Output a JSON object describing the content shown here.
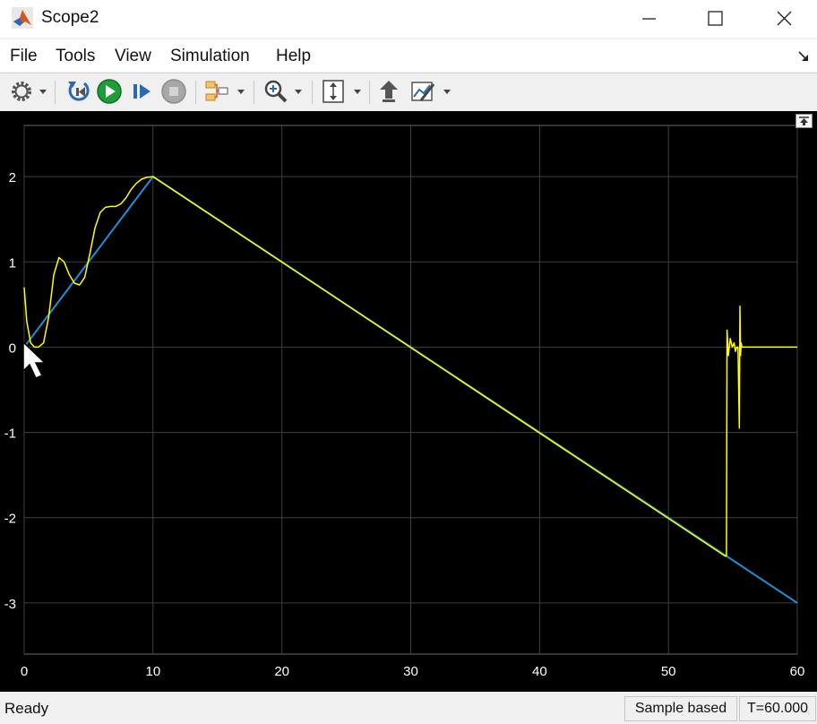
{
  "window": {
    "title": "Scope2"
  },
  "menu": {
    "items": [
      "File",
      "Tools",
      "View",
      "Simulation",
      "Help"
    ]
  },
  "toolbar": {
    "icons": [
      "gear-icon",
      "step-back-icon",
      "run-icon",
      "step-forward-icon",
      "stop-icon",
      "signal-triggers-icon",
      "zoom-icon",
      "scale-axes-icon",
      "highlight-block-icon",
      "style-icon"
    ]
  },
  "status": {
    "ready": "Ready",
    "mode": "Sample based",
    "time": "T=60.000"
  },
  "colors": {
    "background": "#000000",
    "grid": "#404040",
    "axis_text": "#ffffff",
    "signal1": "#ffff00",
    "signal2": "#1e90d6"
  },
  "chart_data": {
    "type": "line",
    "title": "",
    "xlabel": "",
    "ylabel": "",
    "xlim": [
      0,
      60
    ],
    "ylim": [
      -3.6,
      2.6
    ],
    "xticks": [
      0,
      10,
      20,
      30,
      40,
      50,
      60
    ],
    "yticks": [
      -3,
      -2,
      -1,
      0,
      1,
      2
    ],
    "grid": true,
    "series": [
      {
        "color": "#1e90d6",
        "x": [
          0,
          10,
          60
        ],
        "y": [
          0,
          2,
          -3
        ]
      },
      {
        "color": "#ffff00",
        "x": [
          0,
          0.2,
          0.5,
          0.8,
          1.1,
          1.5,
          1.9,
          2.3,
          2.7,
          3.1,
          3.5,
          3.9,
          4.3,
          4.7,
          5.1,
          5.5,
          5.9,
          6.3,
          6.7,
          7.1,
          7.5,
          7.9,
          8.3,
          8.7,
          9.1,
          9.5,
          10,
          54.4,
          54.5,
          54.55,
          54.65,
          54.8,
          54.95,
          55.1,
          55.2,
          55.3,
          55.4,
          55.5,
          55.55,
          55.6,
          55.65,
          55.7,
          55.8,
          56,
          60
        ],
        "y": [
          0.7,
          0.3,
          0.05,
          0.0,
          0.0,
          0.05,
          0.35,
          0.85,
          1.05,
          1.0,
          0.85,
          0.75,
          0.73,
          0.82,
          1.1,
          1.4,
          1.58,
          1.64,
          1.65,
          1.65,
          1.68,
          1.75,
          1.85,
          1.92,
          1.97,
          1.99,
          2.0,
          -2.45,
          -2.45,
          0.2,
          -0.1,
          0.1,
          0.0,
          0.05,
          -0.05,
          0.0,
          0.0,
          -0.95,
          0.48,
          -0.1,
          0.05,
          0.0,
          0.0,
          0.0,
          0.0
        ]
      }
    ]
  }
}
